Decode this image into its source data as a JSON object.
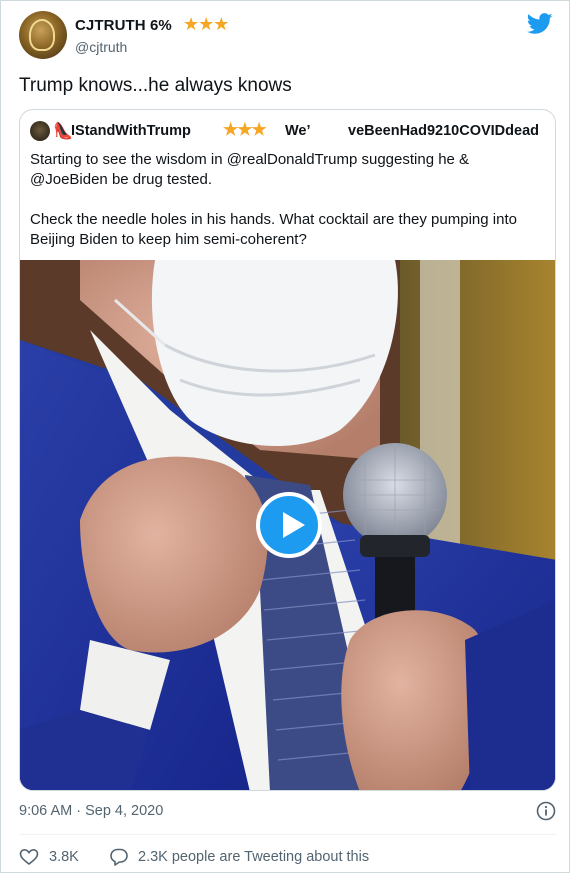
{
  "tweet": {
    "display_name": "CJTRUTH 6%",
    "name_stars": "★★★",
    "handle": "@cjtruth",
    "text": "Trump knows...he always knows",
    "timestamp": "9:06 AM · Sep 4, 2020",
    "likes": "3.8K",
    "replies_text": "2.3K people are Tweeting about this"
  },
  "quote": {
    "name_part1": "IStandWithTrump",
    "name_stars": "★★★",
    "name_part2": "We’",
    "name_part3": "veBeenHad9210COVIDdead",
    "paragraph1": "Starting to see the wisdom in @realDonaldTrump suggesting he & @JoeBiden be drug tested.",
    "paragraph2": "Check the needle holes in his hands. What cocktail are they pumping into Beijing Biden to keep him semi-coherent?"
  },
  "icons": {
    "brand": "twitter-bird-icon",
    "play": "play-icon",
    "info": "info-icon",
    "like": "heart-icon",
    "reply": "speech-bubble-icon",
    "heel": "high-heel-icon"
  },
  "colors": {
    "accent": "#1d9bf0",
    "star": "#f5a623",
    "muted": "#536471"
  }
}
